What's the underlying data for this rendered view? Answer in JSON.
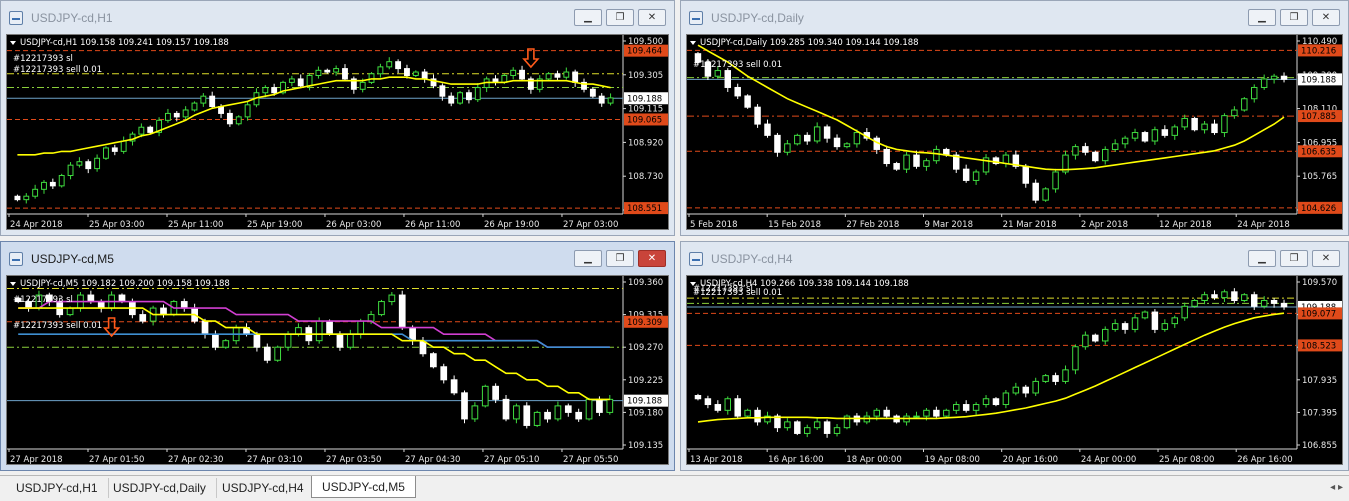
{
  "tabs": [
    {
      "label": "USDJPY-cd,H1"
    },
    {
      "label": "USDJPY-cd,Daily"
    },
    {
      "label": "USDJPY-cd,H4"
    },
    {
      "label": "USDJPY-cd,M5"
    }
  ],
  "active_tab": 3,
  "window_buttons": {
    "minimize": "▁",
    "restore": "❐",
    "close": "✕"
  },
  "colors": {
    "background": "#000000",
    "bull": "#3fdc3f",
    "bear": "#ffffff",
    "ma": "#ffff00",
    "ma2": "#d13fd1",
    "ma3": "#3f8fd1",
    "bid": "#6ea3c9",
    "level_red": "#e04a1a",
    "level_green": "#8bcf3a",
    "level_yellow": "#dede2a"
  },
  "windows": [
    {
      "id": "h1",
      "title": "USDJPY-cd,H1",
      "info": "USDJPY-cd,H1  109.158 109.241 109.157 109.188",
      "order_labels": [
        "#12217393 sl",
        "#12217393 sell 0.01"
      ],
      "price_ticks": [
        "109.500",
        "109.305",
        "109.115",
        "108.920",
        "108.730",
        "108.540"
      ],
      "price_tags": [
        {
          "text": "109.464",
          "color": "#e04a1a"
        },
        {
          "text": "109.188",
          "color": "#ffffff"
        },
        {
          "text": "109.065",
          "color": "#e04a1a"
        },
        {
          "text": "108.551",
          "color": "#e04a1a"
        }
      ],
      "time_ticks": [
        "24 Apr 2018",
        "25 Apr 03:00",
        "25 Apr 11:00",
        "25 Apr 19:00",
        "26 Apr 03:00",
        "26 Apr 11:00",
        "26 Apr 19:00",
        "27 Apr 03:00"
      ]
    },
    {
      "id": "daily",
      "title": "USDJPY-cd,Daily",
      "info": "USDJPY-cd,Daily  109.285 109.340 109.144 109.188",
      "order_labels": [
        "#12217393 sell 0.01"
      ],
      "price_ticks": [
        "110.490",
        "109.300",
        "108.110",
        "106.955",
        "105.765",
        "104.575"
      ],
      "price_tags": [
        {
          "text": "110.216",
          "color": "#e04a1a"
        },
        {
          "text": "109.188",
          "color": "#ffffff"
        },
        {
          "text": "107.885",
          "color": "#e04a1a"
        },
        {
          "text": "106.635",
          "color": "#e04a1a"
        },
        {
          "text": "104.626",
          "color": "#e04a1a"
        }
      ],
      "time_ticks": [
        "5 Feb 2018",
        "15 Feb 2018",
        "27 Feb 2018",
        "9 Mar 2018",
        "21 Mar 2018",
        "2 Apr 2018",
        "12 Apr 2018",
        "24 Apr 2018"
      ]
    },
    {
      "id": "m5",
      "title": "USDJPY-cd,M5",
      "info": "USDJPY-cd,M5  109.182 109.200 109.158 109.188",
      "order_labels": [
        "#12217393 sl",
        "#12217393 sell 0.01"
      ],
      "price_ticks": [
        "109.360",
        "109.315",
        "109.270",
        "109.225",
        "109.180",
        "109.135"
      ],
      "price_tags": [
        {
          "text": "109.309",
          "color": "#e04a1a"
        },
        {
          "text": "109.188",
          "color": "#ffffff"
        }
      ],
      "time_ticks": [
        "27 Apr 2018",
        "27 Apr 01:50",
        "27 Apr 02:30",
        "27 Apr 03:10",
        "27 Apr 03:50",
        "27 Apr 04:30",
        "27 Apr 05:10",
        "27 Apr 05:50"
      ]
    },
    {
      "id": "h4",
      "title": "USDJPY-cd,H4",
      "info": "USDJPY-cd,H4  109.266 109.338 109.144 109.188",
      "order_labels": [
        "#12217393 sl",
        "#12217393 sell 0.01"
      ],
      "price_ticks": [
        "109.570",
        "109.015",
        "108.475",
        "107.935",
        "107.395",
        "106.855"
      ],
      "price_tags": [
        {
          "text": "109.188",
          "color": "#ffffff"
        },
        {
          "text": "109.077",
          "color": "#e04a1a"
        },
        {
          "text": "108.523",
          "color": "#e04a1a"
        }
      ],
      "time_ticks": [
        "13 Apr 2018",
        "16 Apr 16:00",
        "18 Apr 00:00",
        "19 Apr 08:00",
        "20 Apr 16:00",
        "24 Apr 00:00",
        "25 Apr 08:00",
        "26 Apr 16:00"
      ]
    }
  ],
  "chart_data": [
    {
      "type": "candlestick",
      "title": "USDJPY-cd,H1",
      "ylim": [
        108.54,
        109.52
      ],
      "current": 109.188,
      "levels": [
        {
          "value": 109.464,
          "style": "dash",
          "color": "#e04a1a"
        },
        {
          "value": 109.33,
          "style": "dashdot",
          "color": "#dede2a"
        },
        {
          "value": 109.25,
          "style": "dashdot",
          "color": "#8bcf3a"
        },
        {
          "value": 109.065,
          "style": "dash",
          "color": "#e04a1a"
        },
        {
          "value": 108.551,
          "style": "dash",
          "color": "#e04a1a"
        }
      ],
      "closes": [
        108.6,
        108.62,
        108.66,
        108.7,
        108.68,
        108.74,
        108.8,
        108.82,
        108.78,
        108.84,
        108.9,
        108.88,
        108.94,
        108.98,
        109.02,
        108.99,
        109.06,
        109.1,
        109.08,
        109.12,
        109.16,
        109.2,
        109.14,
        109.1,
        109.04,
        109.08,
        109.15,
        109.22,
        109.25,
        109.22,
        109.28,
        109.3,
        109.26,
        109.32,
        109.35,
        109.34,
        109.36,
        109.3,
        109.24,
        109.28,
        109.33,
        109.37,
        109.4,
        109.36,
        109.32,
        109.34,
        109.3,
        109.26,
        109.2,
        109.16,
        109.22,
        109.18,
        109.25,
        109.3,
        109.28,
        109.32,
        109.35,
        109.3,
        109.24,
        109.3,
        109.33,
        109.31,
        109.34,
        109.28,
        109.24,
        109.2,
        109.16,
        109.19
      ],
      "ma": [
        108.86,
        108.86,
        108.86,
        108.87,
        108.87,
        108.88,
        108.88,
        108.89,
        108.9,
        108.91,
        108.92,
        108.93,
        108.94,
        108.95,
        108.97,
        108.98,
        109.0,
        109.02,
        109.04,
        109.06,
        109.09,
        109.11,
        109.13,
        109.14,
        109.15,
        109.16,
        109.17,
        109.19,
        109.2,
        109.21,
        109.23,
        109.24,
        109.25,
        109.26,
        109.27,
        109.28,
        109.29,
        109.29,
        109.29,
        109.29,
        109.3,
        109.3,
        109.31,
        109.31,
        109.31,
        109.3,
        109.3,
        109.29,
        109.28,
        109.27,
        109.27,
        109.27,
        109.27,
        109.28,
        109.28,
        109.28,
        109.29,
        109.29,
        109.29,
        109.29,
        109.29,
        109.29,
        109.29,
        109.28,
        109.27,
        109.27,
        109.26,
        109.25
      ]
    },
    {
      "type": "candlestick",
      "title": "USDJPY-cd,Daily",
      "ylim": [
        104.55,
        110.55
      ],
      "current": 109.188,
      "levels": [
        {
          "value": 110.216,
          "style": "dash",
          "color": "#e04a1a"
        },
        {
          "value": 109.25,
          "style": "dashdot",
          "color": "#8bcf3a"
        },
        {
          "value": 107.885,
          "style": "dashdot",
          "color": "#e04a1a"
        },
        {
          "value": 106.635,
          "style": "dash",
          "color": "#e04a1a"
        },
        {
          "value": 104.626,
          "style": "dash",
          "color": "#e04a1a"
        }
      ],
      "closes": [
        109.8,
        109.3,
        109.5,
        108.9,
        108.6,
        108.2,
        107.6,
        107.2,
        106.6,
        106.9,
        107.2,
        107.0,
        107.5,
        107.1,
        106.8,
        106.9,
        107.3,
        107.1,
        106.7,
        106.2,
        106.0,
        106.5,
        106.1,
        106.3,
        106.7,
        106.5,
        106.0,
        105.6,
        105.9,
        106.4,
        106.2,
        106.5,
        106.1,
        105.5,
        104.9,
        105.3,
        105.9,
        106.5,
        106.8,
        106.6,
        106.3,
        106.7,
        106.9,
        107.1,
        107.3,
        107.0,
        107.4,
        107.2,
        107.5,
        107.8,
        107.4,
        107.6,
        107.3,
        107.9,
        108.1,
        108.5,
        108.9,
        109.2,
        109.3,
        109.19
      ],
      "ma": [
        110.4,
        110.2,
        110.0,
        109.8,
        109.55,
        109.3,
        109.1,
        108.9,
        108.7,
        108.5,
        108.35,
        108.2,
        108.05,
        107.9,
        107.75,
        107.55,
        107.35,
        107.15,
        106.95,
        106.8,
        106.7,
        106.65,
        106.6,
        106.58,
        106.55,
        106.5,
        106.45,
        106.4,
        106.35,
        106.3,
        106.25,
        106.2,
        106.15,
        106.1,
        106.05,
        106.0,
        105.98,
        105.98,
        106.0,
        106.02,
        106.05,
        106.1,
        106.15,
        106.2,
        106.25,
        106.3,
        106.35,
        106.4,
        106.45,
        106.5,
        106.55,
        106.6,
        106.65,
        106.75,
        106.85,
        107.0,
        107.2,
        107.4,
        107.6,
        107.85
      ]
    },
    {
      "type": "candlestick",
      "title": "USDJPY-cd,M5",
      "ylim": [
        109.12,
        109.37
      ],
      "current": 109.188,
      "levels": [
        {
          "value": 109.36,
          "style": "dashdot",
          "color": "#dede2a"
        },
        {
          "value": 109.309,
          "style": "dash",
          "color": "#e04a1a"
        },
        {
          "value": 109.27,
          "style": "dashdot",
          "color": "#8bcf3a"
        }
      ],
      "closes": [
        109.34,
        109.33,
        109.35,
        109.34,
        109.32,
        109.33,
        109.35,
        109.34,
        109.33,
        109.35,
        109.34,
        109.32,
        109.31,
        109.33,
        109.32,
        109.34,
        109.33,
        109.31,
        109.29,
        109.27,
        109.28,
        109.3,
        109.29,
        109.27,
        109.25,
        109.27,
        109.29,
        109.3,
        109.28,
        109.31,
        109.29,
        109.27,
        109.29,
        109.31,
        109.32,
        109.34,
        109.35,
        109.3,
        109.28,
        109.26,
        109.24,
        109.22,
        109.2,
        109.16,
        109.18,
        109.21,
        109.19,
        109.16,
        109.18,
        109.15,
        109.17,
        109.16,
        109.18,
        109.17,
        109.16,
        109.19,
        109.17,
        109.19
      ],
      "ma": [
        109.33,
        109.33,
        109.33,
        109.33,
        109.33,
        109.33,
        109.33,
        109.33,
        109.33,
        109.33,
        109.33,
        109.33,
        109.33,
        109.32,
        109.32,
        109.32,
        109.32,
        109.32,
        109.31,
        109.31,
        109.3,
        109.3,
        109.3,
        109.29,
        109.29,
        109.29,
        109.29,
        109.29,
        109.29,
        109.29,
        109.29,
        109.29,
        109.29,
        109.29,
        109.29,
        109.29,
        109.29,
        109.28,
        109.28,
        109.28,
        109.27,
        109.27,
        109.26,
        109.26,
        109.25,
        109.25,
        109.24,
        109.23,
        109.23,
        109.22,
        109.22,
        109.21,
        109.21,
        109.2,
        109.2,
        109.19,
        109.19,
        109.19
      ],
      "ma2": [
        109.33,
        109.33,
        109.33,
        109.34,
        109.34,
        109.34,
        109.34,
        109.34,
        109.34,
        109.34,
        109.34,
        109.34,
        109.34,
        109.34,
        109.34,
        109.33,
        109.33,
        109.33,
        109.33,
        109.33,
        109.33,
        109.32,
        109.32,
        109.32,
        109.32,
        109.32,
        109.32,
        109.31,
        109.31,
        109.31,
        109.31,
        109.31,
        109.31,
        109.31,
        109.31,
        109.3,
        109.3,
        109.3,
        109.3,
        109.3,
        109.3,
        109.29,
        109.29,
        109.29,
        109.29,
        109.29,
        109.28,
        109.28,
        109.28,
        109.28,
        109.28,
        109.27,
        109.27,
        109.27,
        109.27,
        109.27,
        109.27,
        109.27
      ],
      "ma3": [
        109.29,
        109.29,
        109.29,
        109.29,
        109.29,
        109.29,
        109.29,
        109.29,
        109.29,
        109.29,
        109.29,
        109.29,
        109.29,
        109.29,
        109.29,
        109.29,
        109.29,
        109.29,
        109.29,
        109.29,
        109.29,
        109.29,
        109.29,
        109.29,
        109.29,
        109.29,
        109.29,
        109.29,
        109.29,
        109.29,
        109.29,
        109.29,
        109.29,
        109.29,
        109.29,
        109.29,
        109.29,
        109.29,
        109.28,
        109.28,
        109.28,
        109.28,
        109.28,
        109.28,
        109.28,
        109.28,
        109.28,
        109.28,
        109.28,
        109.28,
        109.28,
        109.27,
        109.27,
        109.27,
        109.27,
        109.27,
        109.27,
        109.27
      ]
    },
    {
      "type": "candlestick",
      "title": "USDJPY-cd,H4",
      "ylim": [
        106.8,
        109.62
      ],
      "current": 109.188,
      "levels": [
        {
          "value": 109.34,
          "style": "dashdot",
          "color": "#dede2a"
        },
        {
          "value": 109.25,
          "style": "dashdot",
          "color": "#8bcf3a"
        },
        {
          "value": 109.077,
          "style": "dash",
          "color": "#e04a1a"
        },
        {
          "value": 108.523,
          "style": "dash",
          "color": "#e04a1a"
        }
      ],
      "closes": [
        107.6,
        107.5,
        107.4,
        107.6,
        107.3,
        107.4,
        107.2,
        107.3,
        107.1,
        107.2,
        107.0,
        107.1,
        107.2,
        107.0,
        107.1,
        107.3,
        107.2,
        107.3,
        107.4,
        107.3,
        107.2,
        107.3,
        107.3,
        107.4,
        107.3,
        107.4,
        107.5,
        107.4,
        107.5,
        107.6,
        107.5,
        107.7,
        107.8,
        107.7,
        107.9,
        108.0,
        107.9,
        108.1,
        108.5,
        108.7,
        108.6,
        108.8,
        108.9,
        108.8,
        109.0,
        109.1,
        108.8,
        108.9,
        109.0,
        109.2,
        109.3,
        109.4,
        109.35,
        109.45,
        109.3,
        109.4,
        109.2,
        109.3,
        109.25,
        109.19
      ],
      "ma": [
        107.2,
        107.22,
        107.24,
        107.25,
        107.26,
        107.27,
        107.27,
        107.28,
        107.28,
        107.28,
        107.28,
        107.28,
        107.27,
        107.27,
        107.26,
        107.26,
        107.26,
        107.26,
        107.26,
        107.26,
        107.26,
        107.26,
        107.26,
        107.26,
        107.26,
        107.27,
        107.28,
        107.29,
        107.31,
        107.33,
        107.35,
        107.38,
        107.41,
        107.44,
        107.48,
        107.52,
        107.56,
        107.61,
        107.68,
        107.75,
        107.82,
        107.9,
        107.98,
        108.06,
        108.14,
        108.22,
        108.3,
        108.38,
        108.46,
        108.54,
        108.62,
        108.7,
        108.77,
        108.84,
        108.9,
        108.95,
        109.0,
        109.03,
        109.06,
        109.08
      ]
    }
  ]
}
